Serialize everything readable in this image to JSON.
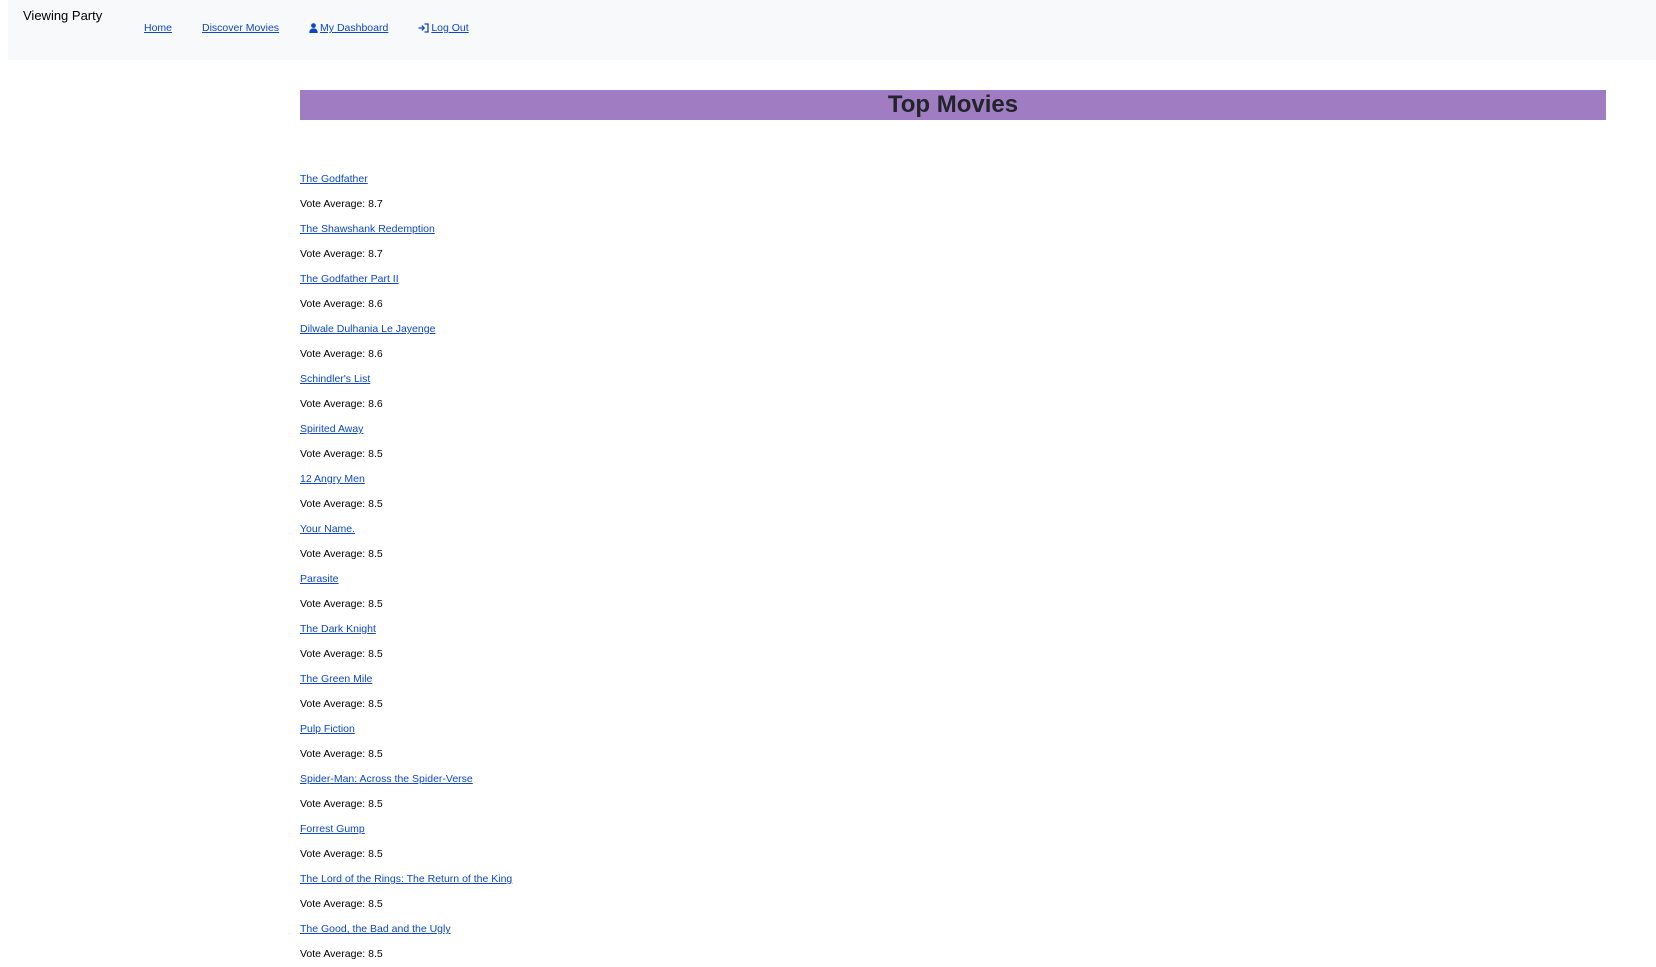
{
  "navbar": {
    "brand": "Viewing Party",
    "links": {
      "home": {
        "label": "Home"
      },
      "discover": {
        "label": "Discover Movies"
      },
      "dashboard": {
        "label": "My Dashboard",
        "icon": "user-icon"
      },
      "logout": {
        "label": "Log Out",
        "icon": "log-out-icon"
      }
    }
  },
  "page": {
    "title": "Top Movies",
    "title_bg_color": "#a07dc3"
  },
  "movies": [
    {
      "title": "The Godfather",
      "vote": "Vote Average: 8.7"
    },
    {
      "title": "The Shawshank Redemption",
      "vote": "Vote Average: 8.7"
    },
    {
      "title": "The Godfather Part II",
      "vote": "Vote Average: 8.6"
    },
    {
      "title": "Dilwale Dulhania Le Jayenge",
      "vote": "Vote Average: 8.6"
    },
    {
      "title": "Schindler's List",
      "vote": "Vote Average: 8.6"
    },
    {
      "title": "Spirited Away",
      "vote": "Vote Average: 8.5"
    },
    {
      "title": "12 Angry Men",
      "vote": "Vote Average: 8.5"
    },
    {
      "title": "Your Name.",
      "vote": "Vote Average: 8.5"
    },
    {
      "title": "Parasite",
      "vote": "Vote Average: 8.5"
    },
    {
      "title": "The Dark Knight",
      "vote": "Vote Average: 8.5"
    },
    {
      "title": "The Green Mile",
      "vote": "Vote Average: 8.5"
    },
    {
      "title": "Pulp Fiction",
      "vote": "Vote Average: 8.5"
    },
    {
      "title": "Spider-Man: Across the Spider-Verse",
      "vote": "Vote Average: 8.5"
    },
    {
      "title": "Forrest Gump",
      "vote": "Vote Average: 8.5"
    },
    {
      "title": "The Lord of the Rings: The Return of the King",
      "vote": "Vote Average: 8.5"
    },
    {
      "title": "The Good, the Bad and the Ugly",
      "vote": "Vote Average: 8.5"
    }
  ]
}
